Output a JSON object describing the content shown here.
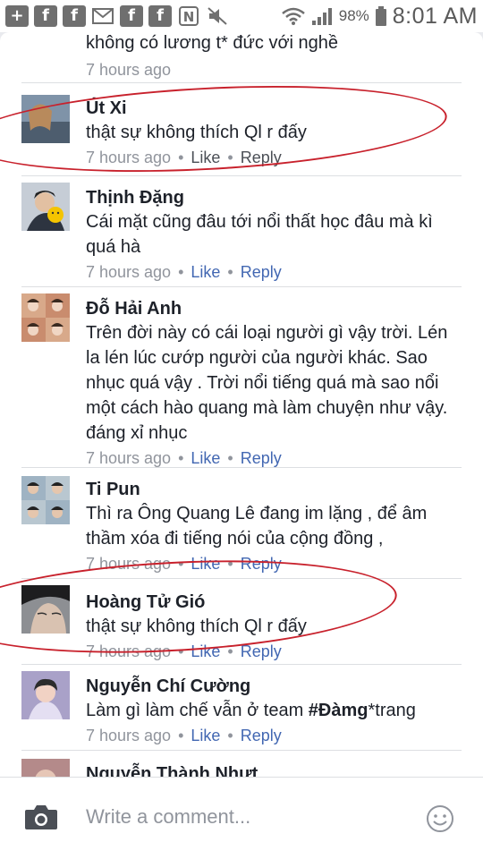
{
  "status_bar": {
    "battery_percent": "98%",
    "time": "8:01 AM",
    "icons": [
      "plus-square-icon",
      "facebook-icon",
      "facebook-icon",
      "mail-icon",
      "facebook-icon",
      "facebook-icon",
      "nfc-icon",
      "mute-icon",
      "wifi-icon",
      "signal-icon",
      "battery-icon"
    ]
  },
  "comments": [
    {
      "name": "",
      "text": "không có lương t* đức với nghề",
      "time": "7 hours ago",
      "like": "",
      "reply": ""
    },
    {
      "name": "Út Xi",
      "text": "thật sự không thích Ql r đấy",
      "time": "7 hours ago",
      "like": "Like",
      "reply": "Reply"
    },
    {
      "name": "Thịnh Đặng",
      "text": "Cái mặt cũng đâu tới nổi thất học đâu mà kì quá hà",
      "time": "7 hours ago",
      "like": "Like",
      "reply": "Reply"
    },
    {
      "name": "Đỗ Hải Anh",
      "text": "Trên đời này có cái loại người gì vậy trời. Lén la lén lúc cướp người của người khác. Sao nhục quá vậy . Trời nổi tiếng quá mà sao nổi một cách hào quang mà làm chuyện như vậy. đáng xỉ nhục",
      "time": "7 hours ago",
      "like": "Like",
      "reply": "Reply"
    },
    {
      "name": "Ti Pun",
      "text": "Thì ra Ông Quang Lê đang im lặng , để âm thầm xóa đi tiếng nói của cộng đồng ,",
      "time": "7 hours ago",
      "like": "Like",
      "reply": "Reply"
    },
    {
      "name": "Hoàng Tử Gió",
      "text": "thật sự không thích Ql r đấy",
      "time": "7 hours ago",
      "like": "Like",
      "reply": "Reply"
    },
    {
      "name": "Nguyễn Chí Cường",
      "text": "Làm gì làm chế vẫn ở team ",
      "text_bold": "#Đàmg",
      "text_after": "*trang",
      "time": "7 hours ago",
      "like": "Like",
      "reply": "Reply"
    },
    {
      "name": "Nguyễn Thành Nhựt",
      "text": "",
      "time": "",
      "like": "",
      "reply": ""
    }
  ],
  "composer": {
    "placeholder": "Write a comment..."
  },
  "colors": {
    "highlight_circle": "#c8212c",
    "link_blue": "#4267b2",
    "meta_gray": "#90949c"
  }
}
